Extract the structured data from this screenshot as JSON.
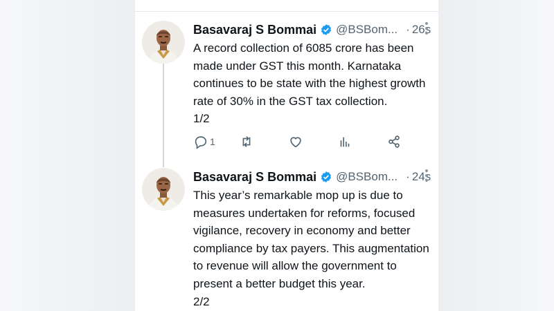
{
  "tweets": [
    {
      "author": "Basavaraj S Bommai",
      "handle": "@BSBom...",
      "separator": "·",
      "time": "26s",
      "lines": [
        "A record collection of 6085 crore has been",
        "made under GST this month. Karnataka",
        "continues to be state with the highest growth",
        "rate of 30% in the GST tax collection.",
        "1/2"
      ],
      "actions": {
        "reply_count": "1"
      }
    },
    {
      "author": "Basavaraj S Bommai",
      "handle": "@BSBom...",
      "separator": "·",
      "time": "24s",
      "lines": [
        "This year’s remarkable mop up is due to",
        "measures undertaken for reforms, focused",
        "vigilance, recovery in economy and better",
        "compliance by tax payers. This augmentation",
        "to revenue will allow the government to",
        "present a better budget this year.",
        "2/2"
      ]
    }
  ],
  "colors": {
    "verified": "#1d9bf0",
    "secondary_text": "#536471",
    "primary_text": "#0f1419"
  },
  "icons": [
    "verified-badge-icon",
    "more-options-icon",
    "reply-icon",
    "retweet-icon",
    "like-icon",
    "views-icon",
    "share-icon"
  ]
}
